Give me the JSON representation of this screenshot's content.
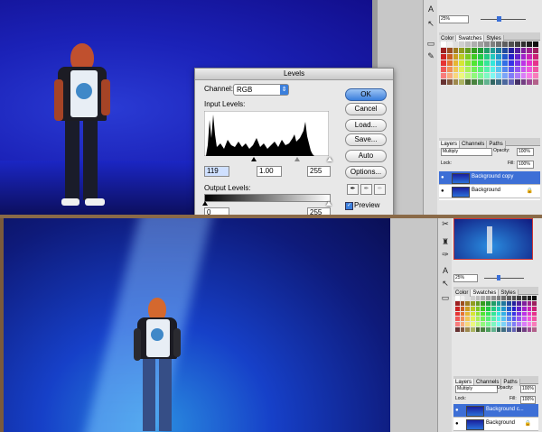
{
  "levels_dialog": {
    "title": "Levels",
    "channel_label": "Channel:",
    "channel_value": "RGB",
    "input_levels_label": "Input Levels:",
    "input_black": "119",
    "input_gamma": "1.00",
    "input_white": "255",
    "output_levels_label": "Output Levels:",
    "output_black": "0",
    "output_white": "255",
    "buttons": {
      "ok": "OK",
      "cancel": "Cancel",
      "load": "Load...",
      "save": "Save...",
      "auto": "Auto",
      "options": "Options..."
    },
    "preview_label": "Preview",
    "preview_checked": true
  },
  "top_panels": {
    "zoom": "25%",
    "palette_tabs": [
      "Color",
      "Swatches",
      "Styles"
    ],
    "layers_tabs": [
      "Layers",
      "Channels",
      "Paths"
    ],
    "blend_mode": "Multiply",
    "opacity_label": "Opacity:",
    "opacity_value": "100%",
    "lock_label": "Lock:",
    "fill_label": "Fill:",
    "fill_value": "100%",
    "layers": [
      {
        "name": "Background copy",
        "selected": true
      },
      {
        "name": "Background",
        "selected": false
      }
    ]
  },
  "bottom_panels": {
    "zoom": "25%",
    "palette_tabs": [
      "Color",
      "Swatches",
      "Styles"
    ],
    "layers_tabs": [
      "Layers",
      "Channels",
      "Paths"
    ],
    "blend_mode": "Multiply",
    "opacity_label": "Opacity:",
    "opacity_value": "100%",
    "lock_label": "Lock:",
    "fill_label": "Fill:",
    "fill_value": "100%",
    "layers": [
      {
        "name": "Background c...",
        "selected": true
      },
      {
        "name": "Background",
        "selected": false
      }
    ]
  },
  "icons": {
    "eye": "eye-icon",
    "lock": "lock-icon",
    "eyedroppers": [
      "black-eyedropper-icon",
      "gray-eyedropper-icon",
      "white-eyedropper-icon"
    ]
  },
  "colors": {
    "canvas_blue": "#1b22b8",
    "selected_layer": "#3d6fd6",
    "ok_button": "#3b7fdc"
  }
}
